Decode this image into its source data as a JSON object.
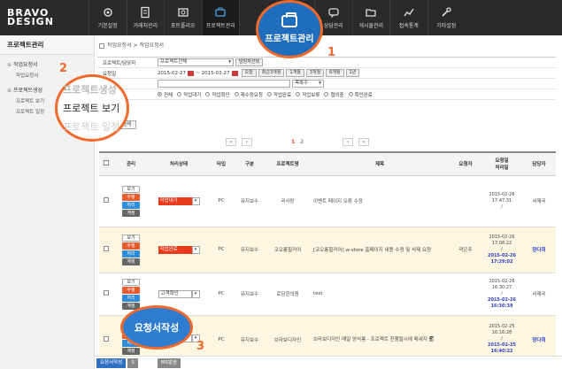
{
  "logo": {
    "line1": "BRAVO",
    "line2": "DESIGN"
  },
  "menu": [
    {
      "label": "기본설정",
      "icon": "gear-icon"
    },
    {
      "label": "거래처관리",
      "icon": "document-icon"
    },
    {
      "label": "포트폴리오",
      "icon": "image-icon"
    },
    {
      "label": "프로젝트관리",
      "icon": "briefcase-icon"
    },
    {
      "label": "",
      "icon": "blank-icon"
    },
    {
      "label": "",
      "icon": "blank-icon"
    },
    {
      "label": "상담관리",
      "icon": "chat-icon"
    },
    {
      "label": "게시물관리",
      "icon": "folder-icon"
    },
    {
      "label": "접속통계",
      "icon": "chart-icon"
    },
    {
      "label": "기타설정",
      "icon": "wrench-icon"
    }
  ],
  "sidebar": {
    "title": "프로젝트관리",
    "groups": [
      {
        "label": "작업요청서",
        "items": [
          "작업요청서"
        ]
      },
      {
        "label": "프로젝트생성",
        "items": [
          "프로젝트 보기",
          "프로젝트 일정"
        ]
      }
    ]
  },
  "breadcrumb": "작업요청서 > 작업요청서",
  "filter": {
    "row1_label": "프로젝트/담당자",
    "project_select": "프로젝트전체",
    "manager_btn": "담당자선택",
    "row2_label": "요청일",
    "date_from": "2015-02-27",
    "date_to": "2015-02-27",
    "range_btns": [
      "오늘",
      "최근3개월",
      "1개월",
      "3개월",
      "6개월",
      "1년"
    ],
    "row3_label": "검색어",
    "search_select": "목록수",
    "row4_label": "처리상태",
    "radios": [
      "전체",
      "작업대기",
      "작업확인",
      "재수정요청",
      "작업완료",
      "작업보류",
      "협의중",
      "확인완료"
    ],
    "search_btn": "검색"
  },
  "pager": {
    "first": "«",
    "prev": "‹",
    "pages": [
      "1",
      "2"
    ],
    "next": "›",
    "last": "»"
  },
  "table": {
    "headers": [
      "",
      "관리",
      "처리상태",
      "타입",
      "구분",
      "프로젝트명",
      "제목",
      "요청자",
      "요청일\n처리일",
      "담당자"
    ],
    "rows": [
      {
        "status": "작업대기",
        "status_plain": false,
        "type": "PC",
        "cat": "유지보수",
        "project": "국사랑",
        "title": "이벤트 페이지 오류 수정",
        "req": "",
        "d1": "2015-02-26",
        "d2": "17:47:31",
        "d3": "/",
        "d4": "",
        "d5": "",
        "mgr": "서재국",
        "mgr_blue": false,
        "hl": false
      },
      {
        "status": "작업완료",
        "status_plain": false,
        "type": "PC",
        "cat": "유지보수",
        "project": "코오롱힐커어",
        "title": "[코오롱힐커어] w-store 홈페이지 내용 수정 및 삭제 요청",
        "req": "곽은주",
        "d1": "2015-02-26",
        "d2": "17:08:22",
        "d3": "/",
        "d4": "2015-02-26",
        "d5": "17:29:02",
        "mgr": "양다희",
        "mgr_blue": true,
        "hl": true
      },
      {
        "status": "고객확인",
        "status_plain": true,
        "type": "PC",
        "cat": "유지보수",
        "project": "로담한의원",
        "title": "test",
        "req": "",
        "d1": "2015-02-26",
        "d2": "16:30:27",
        "d3": "/",
        "d4": "2015-02-26",
        "d5": "16:30:39",
        "mgr": "서재국",
        "mgr_blue": false,
        "hl": false
      },
      {
        "status": "",
        "status_plain": true,
        "type": "PC",
        "cat": "유지보수",
        "project": "브라보디자인",
        "title": "브라보디자인 매일 양식룸 - 프로젝트 진행될시에 메세지 🗐",
        "req": "",
        "d1": "2015-02-25",
        "d2": "16:16:28",
        "d3": "/",
        "d4": "2015-02-25",
        "d5": "16:40:22",
        "mgr": "양다희",
        "mgr_blue": true,
        "hl": true
      }
    ],
    "actions": {
      "view": "보기",
      "edit": "수정",
      "proc": "처리",
      "reject": "계정"
    }
  },
  "bottom": {
    "btn1": "요청서작성",
    "btn2": "S",
    "btn3": "MS발송"
  },
  "annotations": {
    "a1_text": "프로젝트관리",
    "a1_num": "1",
    "a2_t1": "프로젝트생성",
    "a2_t2": "프로젝트 보기",
    "a2_t3": "프로젝트 일정",
    "a2_num": "2",
    "a3_text": "요청서작성",
    "a3_num": "3"
  },
  "colors": {
    "accent": "#f06a2b",
    "blue": "#2e7dd1",
    "topbar": "#2a2a2a"
  }
}
